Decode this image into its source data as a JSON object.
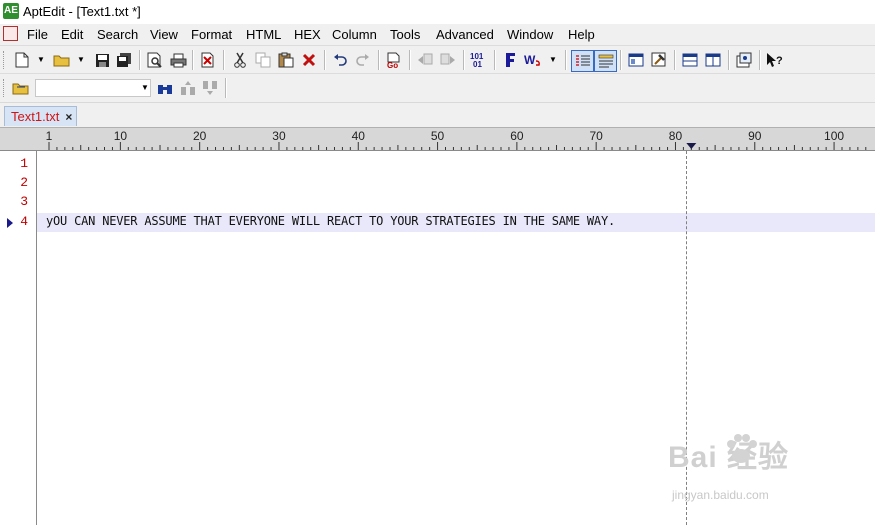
{
  "window": {
    "title": "AptEdit - [Text1.txt *]",
    "app_icon_text": "AE"
  },
  "menu": [
    {
      "name": "file",
      "label": "File"
    },
    {
      "name": "edit",
      "label": "Edit"
    },
    {
      "name": "search",
      "label": "Search"
    },
    {
      "name": "view",
      "label": "View"
    },
    {
      "name": "format",
      "label": "Format"
    },
    {
      "name": "html",
      "label": "HTML"
    },
    {
      "name": "hex",
      "label": "HEX"
    },
    {
      "name": "column",
      "label": "Column"
    },
    {
      "name": "tools",
      "label": "Tools"
    },
    {
      "name": "advanced",
      "label": "Advanced"
    },
    {
      "name": "window",
      "label": "Window"
    },
    {
      "name": "help",
      "label": "Help"
    }
  ],
  "find": {
    "value": ""
  },
  "tabs": [
    {
      "label": "Text1.txt",
      "close": "×"
    }
  ],
  "ruler": {
    "labels": [
      "1",
      "10",
      "20",
      "30",
      "40",
      "50",
      "60",
      "70",
      "80",
      "90",
      "100"
    ]
  },
  "gutter": {
    "lines": [
      "1",
      "2",
      "3",
      "4"
    ]
  },
  "editor": {
    "current_line": 4,
    "line4_text": "yOU CAN NEVER ASSUME THAT EVERYONE WILL REACT TO YOUR STRATEGIES IN THE SAME WAY."
  },
  "watermark": {
    "brand": "Bai  经验",
    "url": "jingyan.baidu.com"
  },
  "colors": {
    "line_number": "#c00000",
    "tab_text": "#d01414",
    "current_line_bg": "#e8e8fa",
    "tab_bg": "#d6e4f5"
  }
}
